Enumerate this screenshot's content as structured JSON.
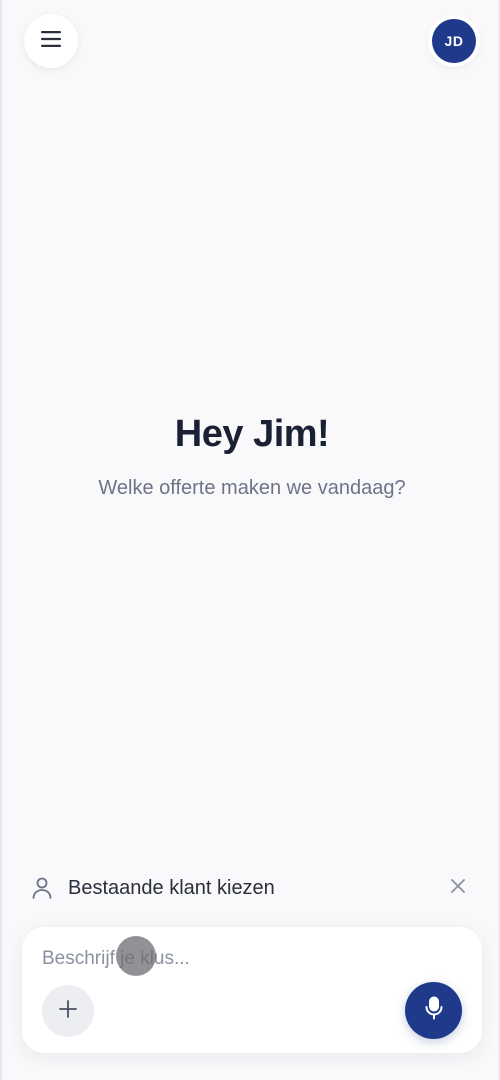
{
  "header": {
    "menu_icon": "hamburger-menu-icon",
    "avatar_initials": "JD",
    "avatar_color": "#1f3a8a"
  },
  "main": {
    "greeting": "Hey Jim!",
    "subtitle": "Welke offerte maken we vandaag?"
  },
  "client_picker": {
    "icon": "person-icon",
    "label": "Bestaande klant kiezen",
    "close_icon": "close-icon"
  },
  "composer": {
    "placeholder": "Beschrijf je klus...",
    "value": "",
    "add_icon": "plus-icon",
    "mic_icon": "microphone-icon",
    "accent_color": "#1f3a8a"
  }
}
